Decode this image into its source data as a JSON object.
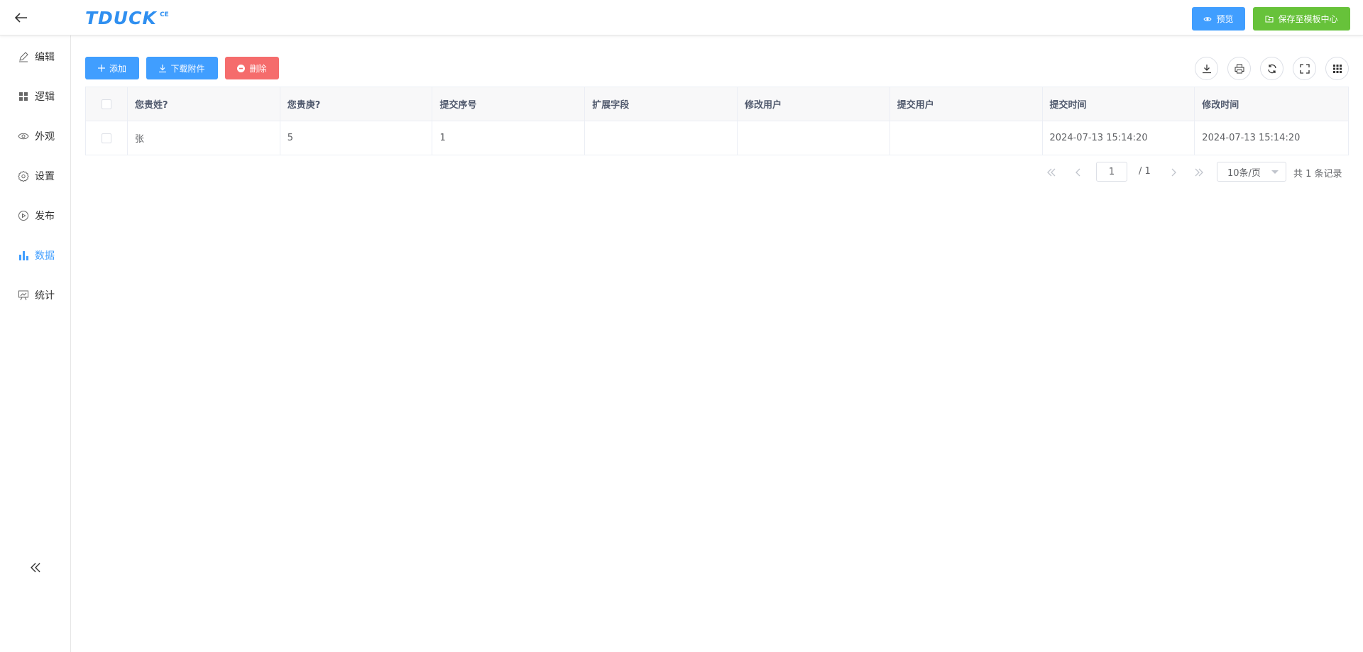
{
  "header": {
    "logo": "TDUCK",
    "logo_sup": "CE",
    "preview_label": "预览",
    "save_label": "保存至模板中心"
  },
  "sidebar": {
    "items": [
      {
        "label": "编辑",
        "icon": "edit-icon"
      },
      {
        "label": "逻辑",
        "icon": "grid-icon"
      },
      {
        "label": "外观",
        "icon": "eye-icon"
      },
      {
        "label": "设置",
        "icon": "gear-icon"
      },
      {
        "label": "发布",
        "icon": "play-circle-icon"
      },
      {
        "label": "数据",
        "icon": "bar-chart-icon"
      },
      {
        "label": "统计",
        "icon": "presentation-icon"
      }
    ],
    "active": "数据"
  },
  "toolbar": {
    "add_label": "添加",
    "download_label": "下载附件",
    "delete_label": "删除"
  },
  "table": {
    "columns": [
      "您贵姓?",
      "您贵庚?",
      "提交序号",
      "扩展字段",
      "修改用户",
      "提交用户",
      "提交时间",
      "修改时间"
    ],
    "rows": [
      [
        "张",
        "5",
        "1",
        "",
        "",
        "",
        "2024-07-13 15:14:20",
        "2024-07-13 15:14:20"
      ]
    ]
  },
  "pager": {
    "current": "1",
    "total_pages": "/ 1",
    "page_size": "10条/页",
    "total_records": "共 1 条记录"
  },
  "colors": {
    "primary": "#409eff",
    "success": "#67c23a",
    "danger": "#f56c6c"
  }
}
